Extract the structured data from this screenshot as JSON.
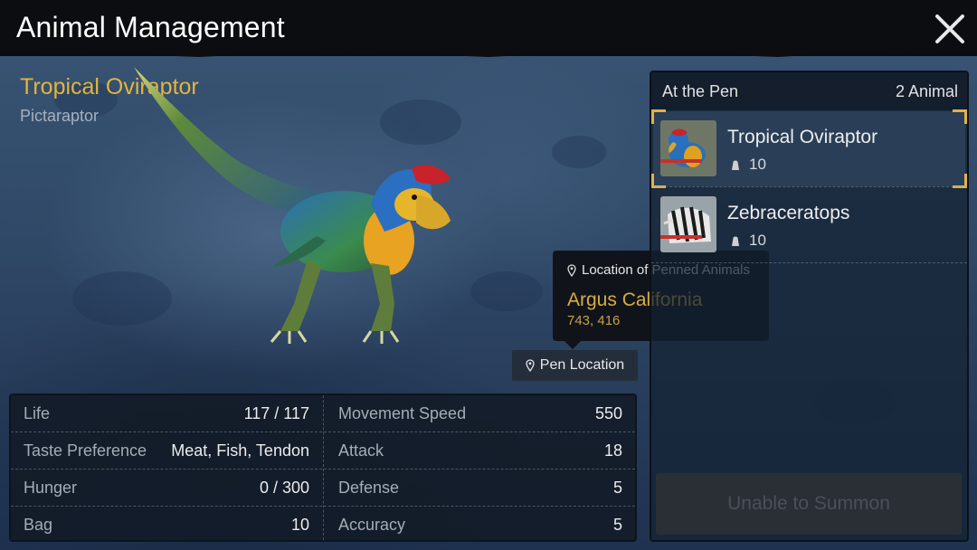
{
  "header": {
    "title": "Animal Management",
    "close_icon": "close-icon"
  },
  "animal": {
    "name": "Tropical Oviraptor",
    "species": "Pictaraptor"
  },
  "stats": {
    "left": [
      {
        "label": "Life",
        "value": "117 / 117"
      },
      {
        "label": "Taste Preference",
        "value": "Meat, Fish, Tendon"
      },
      {
        "label": "Hunger",
        "value": "0 / 300"
      },
      {
        "label": "Bag",
        "value": "10"
      }
    ],
    "right": [
      {
        "label": "Movement Speed",
        "value": "550"
      },
      {
        "label": "Attack",
        "value": "18"
      },
      {
        "label": "Defense",
        "value": "5"
      },
      {
        "label": "Accuracy",
        "value": "5"
      }
    ]
  },
  "tooltip": {
    "heading": "Location of Penned Animals",
    "place": "Argus California",
    "coords": "743, 416",
    "icon": "location-pin-icon"
  },
  "pen_location_button": {
    "label": "Pen Location",
    "icon": "location-pin-icon"
  },
  "pen": {
    "title": "At the Pen",
    "count": "2 Animal",
    "items": [
      {
        "name": "Tropical Oviraptor",
        "level": "10",
        "selected": true
      },
      {
        "name": "Zebraceratops",
        "level": "10",
        "selected": false
      }
    ]
  },
  "summon_button": {
    "label": "Unable to Summon"
  },
  "colors": {
    "accent_gold": "#e3b43e",
    "header_bg": "#0b0d10",
    "hp_red": "#c8302c"
  }
}
